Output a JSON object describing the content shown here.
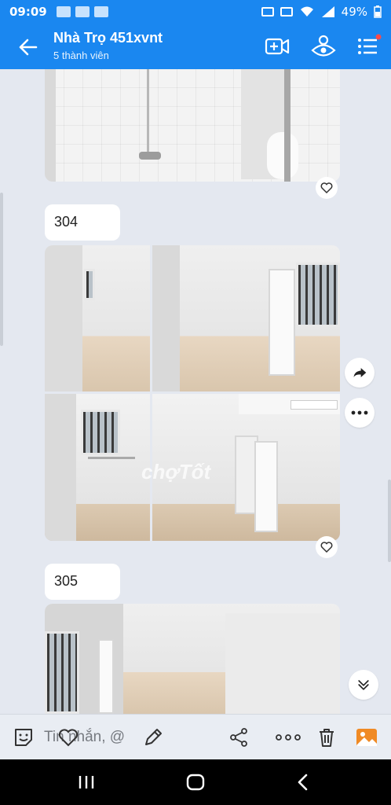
{
  "status_bar": {
    "time": "09:09",
    "battery": "49%"
  },
  "header": {
    "title": "Nhà Trọ 451xvnt",
    "subtitle": "5 thành viên"
  },
  "messages": [
    {
      "label": "304"
    },
    {
      "label": "305"
    }
  ],
  "watermark": "chợTốt",
  "composer": {
    "placeholder": "Tin nhắn, @"
  },
  "icons": {
    "back": "arrow-left-icon",
    "video": "video-add-icon",
    "view": "eye-icon",
    "menu": "list-menu-icon",
    "heart": "heart-icon",
    "share": "share-arrow-icon",
    "more": "more-dots-icon",
    "down": "chevron-down-double-icon",
    "sticker": "sticker-face-icon",
    "draw": "pencil-icon",
    "link": "share-nodes-icon",
    "options": "dots-icon",
    "delete": "trash-icon",
    "gallery": "gallery-icon"
  },
  "colors": {
    "brand": "#1a87f0",
    "background": "#e4e8f0"
  }
}
